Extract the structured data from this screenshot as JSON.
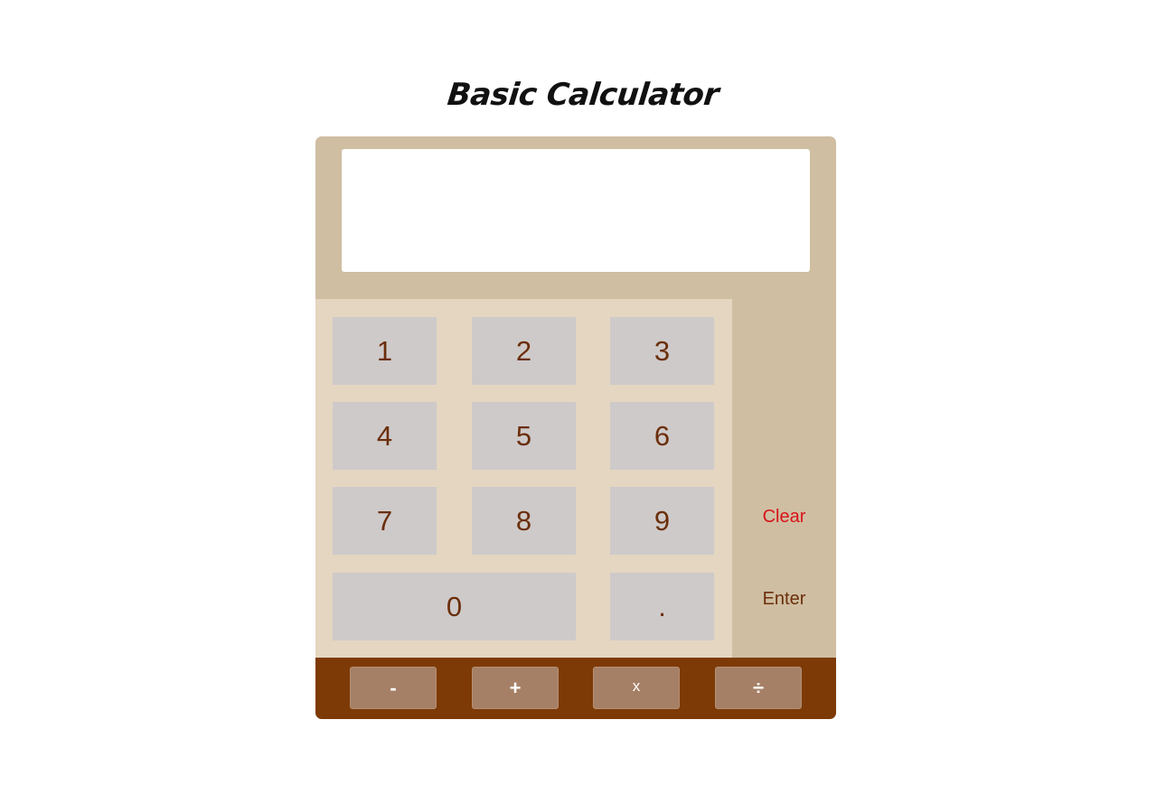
{
  "page": {
    "title": "Basic Calculator"
  },
  "display": {
    "value": ""
  },
  "keys": {
    "k1": "1",
    "k2": "2",
    "k3": "3",
    "k4": "4",
    "k5": "5",
    "k6": "6",
    "k7": "7",
    "k8": "8",
    "k9": "9",
    "k0": "0",
    "decimal": "."
  },
  "side": {
    "clear": "Clear",
    "enter": "Enter"
  },
  "operators": {
    "subtract": "-",
    "add": "+",
    "multiply": "x",
    "divide": "÷"
  },
  "colors": {
    "body": "#cfbea2",
    "keypad": "#e4d6c1",
    "key": "#cecaca",
    "key_text": "#6b2e0a",
    "clear_text": "#d8141a",
    "operator_bar": "#7d3a06",
    "operator_button": "#a68066"
  }
}
